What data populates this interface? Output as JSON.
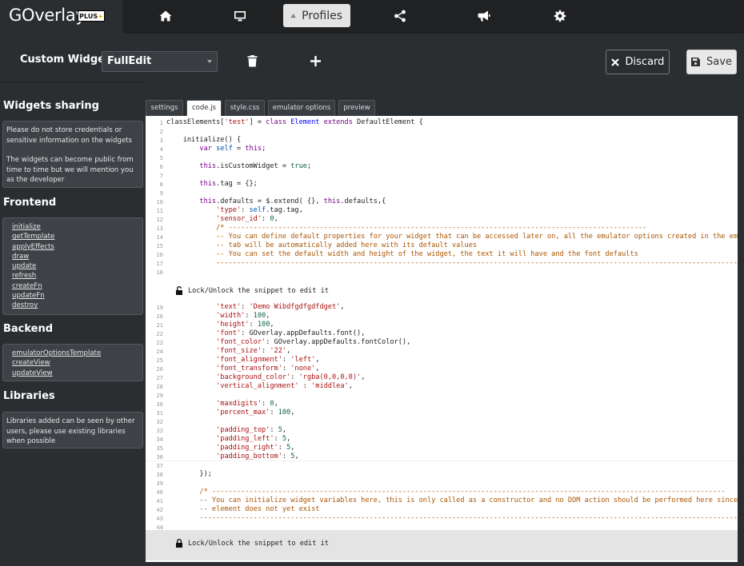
{
  "app": {
    "logo_text": "GOverlay",
    "badge_text": "PLUS",
    "badge_plus": "+"
  },
  "nav": {
    "items": [
      {
        "icon": "home-icon"
      },
      {
        "icon": "monitor-icon"
      },
      {
        "icon": "sitemap-icon",
        "label": "Profiles",
        "active": true
      },
      {
        "icon": "share-icon"
      },
      {
        "icon": "megaphone-icon"
      },
      {
        "icon": "gear-icon"
      }
    ]
  },
  "toolbar": {
    "title": "Custom Widget",
    "select_value": "FullEdit",
    "discard_label": "Discard",
    "save_label": "Save"
  },
  "sidebar": {
    "sharing_title": "Widgets sharing",
    "sharing_text_1": "Please do not store credentials or sensitive information on the widgets",
    "sharing_text_2": "The widgets can become public from time to time but we will mention you as the developer",
    "frontend_title": "Frontend",
    "frontend_links": [
      "initialize",
      "getTemplate",
      "applyEffects",
      "draw",
      "update",
      "refresh",
      "createFn",
      "updateFn",
      "destroy"
    ],
    "backend_title": "Backend",
    "backend_links": [
      "emulatorOptionsTemplate",
      "createView",
      "updateView"
    ],
    "libraries_title": "Libraries",
    "libraries_text": "Libraries added can be seen by other users, please use existing libraries when possible"
  },
  "tabs": [
    "settings",
    "code.js",
    "style.css",
    "emulator options",
    "preview"
  ],
  "active_tab": "code.js",
  "editor": {
    "lock_label": "Lock/Unlock the snippet to edit it",
    "block1": [
      "classElements['test'] = class Element extends DefaultElement {",
      "",
      "    initialize() {",
      "        var self = this;",
      "",
      "        this.isCustomWidget = true;",
      "",
      "        this.tag = {};",
      "",
      "        this.defaults = $.extend( {}, this.defaults,{",
      "            'type': self.tag.tag,",
      "            'sensor_id': 0,",
      "            /* -----------------------------------------------------------------------------------------------------",
      "            -- You can define default properties for your widget that can be accessed later on, all the emulator options created in the emul",
      "            -- tab will be automatically added here with its default values",
      "            -- You can set the default width and height of the widget, the text it will have and the font defaults",
      "            -------------------------------------------------------------------------------------------------------------------------------------",
      ""
    ],
    "block2": [
      "            'text': 'Demo Wibdfgdfgdfdget',",
      "            'width': 100,",
      "            'height': 100,",
      "            'font': GOverlay.appDefaults.font(),",
      "            'font_color': GOverlay.appDefaults.fontColor(),",
      "            'font_size': '22',",
      "            'font_alignment': 'left',",
      "            'font_transform': 'none',",
      "            'background_color': 'rgba(0,0,0,0)',",
      "            'vertical_alignment' : 'middlea',",
      "",
      "            'maxdigits': 0,",
      "            'percent_max': 100,",
      "",
      "            'padding_top': 5,",
      "            'padding_left': 5,",
      "            'padding_right': 5,",
      "            'padding_bottom': 5,"
    ],
    "block3": [
      "",
      "        });",
      "",
      "        /* ----------------------------------------------------------------------------------------------------------------------------",
      "        -- You can initialize widget variables here, this is only called as a constructor and no DOM action should be performed here since t",
      "        -- element does not yet exist",
      "        -------------------------------------------------------------------------------------------------------------------------------------",
      ""
    ],
    "block1_start": 1,
    "block2_start": 19,
    "block3_start": 37
  }
}
